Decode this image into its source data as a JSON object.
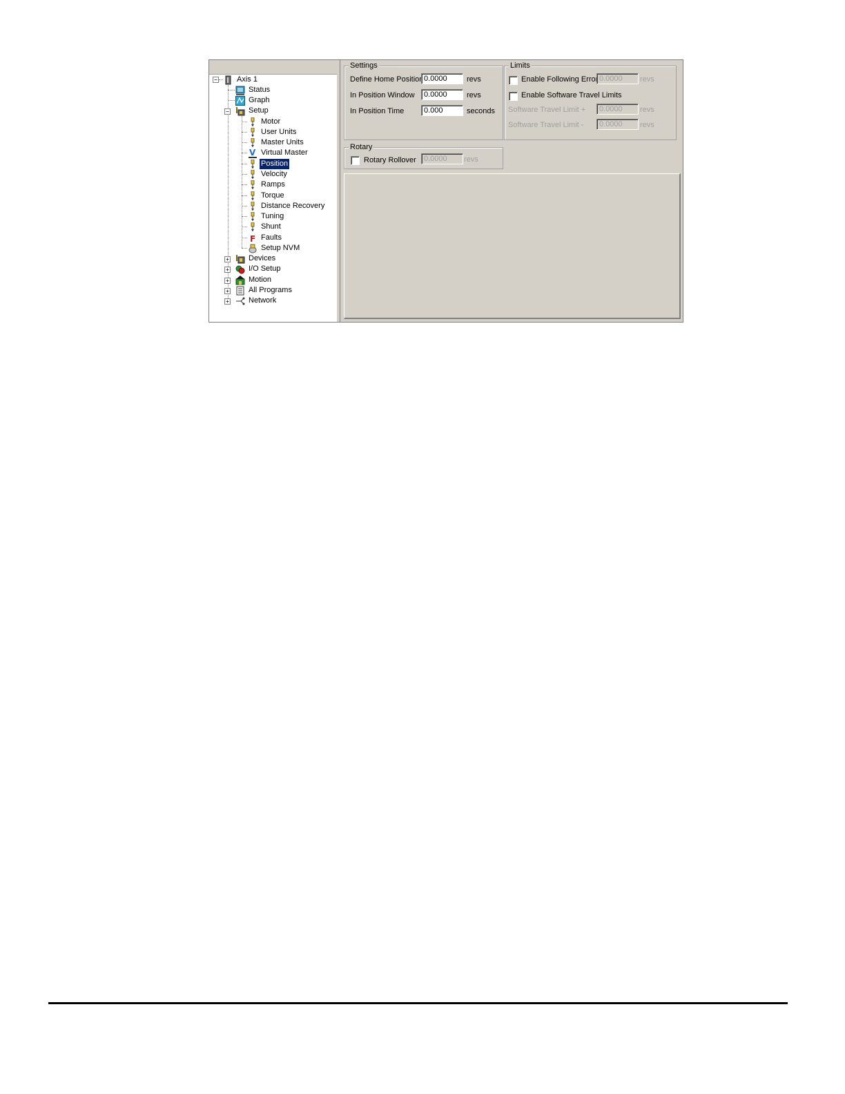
{
  "tree": {
    "root": {
      "label": "Axis 1",
      "icon": "axis-icon",
      "expanded": true
    },
    "children": [
      {
        "label": "Status",
        "icon": "status-icon"
      },
      {
        "label": "Graph",
        "icon": "graph-icon"
      },
      {
        "label": "Setup",
        "icon": "setup-icon",
        "expanded": true,
        "children": [
          {
            "label": "Motor",
            "icon": "parameter-icon"
          },
          {
            "label": "User Units",
            "icon": "parameter-icon"
          },
          {
            "label": "Master Units",
            "icon": "parameter-icon"
          },
          {
            "label": "Virtual Master",
            "icon": "virtual-master-icon"
          },
          {
            "label": "Position",
            "icon": "parameter-icon",
            "selected": true
          },
          {
            "label": "Velocity",
            "icon": "parameter-icon"
          },
          {
            "label": "Ramps",
            "icon": "parameter-icon"
          },
          {
            "label": "Torque",
            "icon": "parameter-icon"
          },
          {
            "label": "Distance Recovery",
            "icon": "parameter-icon"
          },
          {
            "label": "Tuning",
            "icon": "parameter-icon"
          },
          {
            "label": "Shunt",
            "icon": "parameter-icon"
          },
          {
            "label": "Faults",
            "icon": "faults-icon"
          },
          {
            "label": "Setup NVM",
            "icon": "nvm-icon"
          }
        ]
      },
      {
        "label": "Devices",
        "icon": "devices-icon",
        "expanded": false
      },
      {
        "label": "I/O Setup",
        "icon": "io-setup-icon",
        "expanded": false
      },
      {
        "label": "Motion",
        "icon": "motion-icon",
        "expanded": false
      },
      {
        "label": "All Programs",
        "icon": "programs-icon",
        "expanded": false
      },
      {
        "label": "Network",
        "icon": "network-icon",
        "expanded": false
      }
    ],
    "expand_sign": "+",
    "collapse_sign": "−"
  },
  "settings": {
    "title": "Settings",
    "define_home_position": {
      "label": "Define Home Position",
      "value": "0.0000",
      "unit": "revs"
    },
    "in_position_window": {
      "label": "In Position Window",
      "value": "0.0000",
      "unit": "revs"
    },
    "in_position_time": {
      "label": "In Position Time",
      "value": "0.000",
      "unit": "seconds"
    }
  },
  "limits": {
    "title": "Limits",
    "enable_following_error": {
      "label": "Enable Following Error",
      "checked": false,
      "value": "0.0000",
      "unit": "revs"
    },
    "enable_software_travel_limits": {
      "label": "Enable Software Travel Limits",
      "checked": false
    },
    "travel_limit_plus": {
      "label": "Software Travel Limit +",
      "value": "0.0000",
      "unit": "revs"
    },
    "travel_limit_minus": {
      "label": "Software Travel Limit -",
      "value": "0.0000",
      "unit": "revs"
    }
  },
  "rotary": {
    "title": "Rotary",
    "rotary_rollover": {
      "label": "Rotary Rollover",
      "checked": false,
      "value": "0.0000",
      "unit": "revs"
    }
  },
  "colors": {
    "panel": "#d4d0c8",
    "selection": "#0a246a",
    "disabled_text": "#a0a0a0"
  }
}
